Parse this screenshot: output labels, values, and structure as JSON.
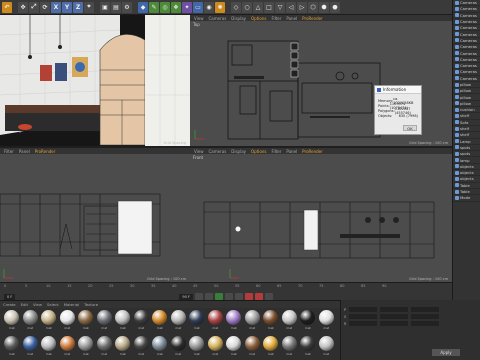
{
  "toolbar": {
    "xyz": [
      "X",
      "Y",
      "Z"
    ]
  },
  "viewport_tl": {
    "menu": [
      "Filter",
      "Panel",
      "ProRender"
    ]
  },
  "viewport_tr": {
    "menu": [
      "View",
      "Cameras",
      "Display",
      "Options",
      "Filter",
      "Panel",
      "ProRender"
    ],
    "label": "Top"
  },
  "viewport_bl": {
    "menu": [
      "Filter",
      "Panel",
      "ProRender"
    ],
    "grid": "Grid Spacing : 100 cm"
  },
  "viewport_br": {
    "menu": [
      "View",
      "Cameras",
      "Display",
      "Options",
      "Filter",
      "Panel",
      "ProRender"
    ],
    "label": "Front",
    "grid": "Grid Spacing : 100 cm"
  },
  "grid_spacing_top_left": "Grid Spacing",
  "grid_spacing_top_right": "Grid Spacing : 100 cm",
  "info_dialog": {
    "title": "Information",
    "rows": [
      {
        "k": "Memory:",
        "v": "ca. 1020038KB"
      },
      {
        "k": "Points:",
        "v": "1103574 (1078474)"
      },
      {
        "k": "Polygons:",
        "v": "1102057 (455746)"
      },
      {
        "k": "Objects:",
        "v": "630 (7998)"
      }
    ],
    "ok": "OK"
  },
  "object_manager": {
    "items": [
      "Cameras",
      "Cameras",
      "Cameras",
      "Cameras",
      "Cameras",
      "Cameras",
      "Cameras",
      "Cameras",
      "Cameras",
      "Cameras",
      "Cameras",
      "Cameras",
      "Cameras",
      "pillow",
      "pillow",
      "pillow",
      "pillow",
      "cushion",
      "shelf",
      "Sofa",
      "shelf",
      "shelf",
      "Lamp",
      "spots",
      "spots",
      "lamp",
      "objects",
      "objects",
      "objects",
      "Table",
      "Table",
      "Mode"
    ]
  },
  "timeline": {
    "ticks": [
      "0",
      "5",
      "10",
      "15",
      "20",
      "25",
      "30",
      "35",
      "40",
      "45",
      "50",
      "55",
      "60",
      "65",
      "70",
      "75",
      "80",
      "85",
      "90"
    ],
    "start": "0 F",
    "current": "90 F"
  },
  "material_manager": {
    "menu": [
      "Create",
      "Edit",
      "View",
      "Select",
      "Material",
      "Texture"
    ],
    "materials": [
      {
        "name": "mat",
        "color": "#c9c2b2"
      },
      {
        "name": "mat",
        "color": "#8c8c8c"
      },
      {
        "name": "mat",
        "color": "#c5b48a"
      },
      {
        "name": "mat",
        "color": "#e7e7e7"
      },
      {
        "name": "mat",
        "color": "#8b6a45"
      },
      {
        "name": "mat",
        "color": "#6d7078"
      },
      {
        "name": "mat",
        "color": "#c0c0c0"
      },
      {
        "name": "mat",
        "color": "#3e3e3e"
      },
      {
        "name": "mat",
        "color": "#d28a2d"
      },
      {
        "name": "mat",
        "color": "#b7b7b7"
      },
      {
        "name": "mat",
        "color": "#2f3d57"
      },
      {
        "name": "mat",
        "color": "#a44"
      },
      {
        "name": "mat",
        "color": "#a07cc4"
      },
      {
        "name": "mat",
        "color": "#9d9d9d"
      },
      {
        "name": "mat",
        "color": "#7b4f2e"
      },
      {
        "name": "mat",
        "color": "#c8c8c8"
      },
      {
        "name": "mat",
        "color": "#1e1e1e"
      },
      {
        "name": "mat",
        "color": "#dedede"
      },
      {
        "name": "mat",
        "color": "#5b5b5b"
      },
      {
        "name": "mat",
        "color": "#3b5fa0"
      },
      {
        "name": "mat",
        "color": "#bdbdbd"
      },
      {
        "name": "mat",
        "color": "#cd7a3a"
      },
      {
        "name": "mat",
        "color": "#9a9a9a"
      },
      {
        "name": "mat",
        "color": "#6f6f6f"
      },
      {
        "name": "mat",
        "color": "#b8a887"
      },
      {
        "name": "mat",
        "color": "#444"
      },
      {
        "name": "mat",
        "color": "#7f8c99"
      },
      {
        "name": "mat",
        "color": "#2b2b2b"
      },
      {
        "name": "mat",
        "color": "#999"
      },
      {
        "name": "mat",
        "color": "#d4b05b"
      },
      {
        "name": "mat",
        "color": "#d9d9d9"
      },
      {
        "name": "mat",
        "color": "#8a5f3a"
      },
      {
        "name": "mat",
        "color": "#e0a93c"
      },
      {
        "name": "mat",
        "color": "#777"
      },
      {
        "name": "mat",
        "color": "#3a3a3a"
      },
      {
        "name": "mat",
        "color": "#c3c3c3"
      }
    ]
  },
  "attributes": {
    "rows": [
      "P",
      "S",
      "R"
    ],
    "apply": "Apply"
  }
}
